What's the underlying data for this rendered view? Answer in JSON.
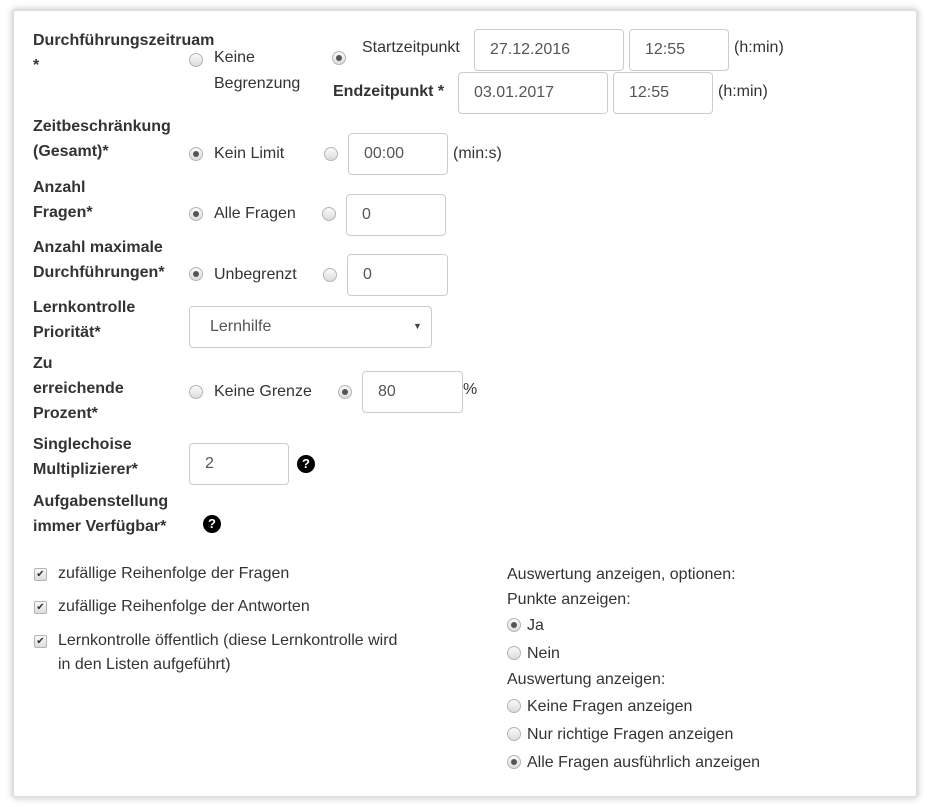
{
  "period": {
    "label": "Durchführungszeitruam",
    "required": "*",
    "no_limit": "Keine",
    "no_limit2": "Begrenzung",
    "start_label": "Startzeitpunkt",
    "start_date": "27.12.2016",
    "start_time": "12:55",
    "time_unit": "(h:min)",
    "end_label": "Endzeitpunkt *",
    "end_date": "03.01.2017",
    "end_time": "12:55",
    "selected": "start"
  },
  "time_limit": {
    "label1": "Zeitbeschränkung",
    "label2": "(Gesamt)*",
    "option": "Kein Limit",
    "value": "00:00",
    "unit": "(min:s)",
    "selected": "no_limit"
  },
  "questions": {
    "label1": "Anzahl",
    "label2": "Fragen*",
    "option": "Alle Fragen",
    "value": "0",
    "selected": "all"
  },
  "max_runs": {
    "label1": "Anzahl maximale",
    "label2": "Durchführungen*",
    "option": "Unbegrenzt",
    "value": "0",
    "selected": "unlimited"
  },
  "priority": {
    "label1": "Lernkontrolle",
    "label2": "Priorität*",
    "value": "Lernhilfe"
  },
  "percent": {
    "label1": "Zu",
    "label2": "erreichende",
    "label3": "Prozent*",
    "option": "Keine Grenze",
    "value": "80",
    "unit": "%",
    "selected": "value"
  },
  "multiplier": {
    "label1": "Singlechoise",
    "label2": "Multiplizierer*",
    "value": "2",
    "help": "?"
  },
  "task": {
    "label1": "Aufgabenstellung",
    "label2": "immer Verfügbar*",
    "help": "?"
  },
  "checkboxes": [
    {
      "label": "zufällige Reihenfolge der Fragen",
      "checked": true
    },
    {
      "label": "zufällige Reihenfolge der Antworten",
      "checked": true
    },
    {
      "label": "Lernkontrolle öffentlich (diese Lernkontrolle wird",
      "label2": "in den Listen aufgeführt)",
      "checked": true
    }
  ],
  "evaluation": {
    "title": "Auswertung anzeigen, optionen:",
    "points_label": "Punkte anzeigen:",
    "yes": "Ja",
    "no": "Nein",
    "show_label": "Auswertung anzeigen:",
    "opt1": "Keine Fragen anzeigen",
    "opt2": "Nur richtige Fragen anzeigen",
    "opt3": "Alle Fragen ausführlich anzeigen",
    "points_selected": "yes",
    "show_selected": "opt3"
  },
  "check_glyph": "✔"
}
